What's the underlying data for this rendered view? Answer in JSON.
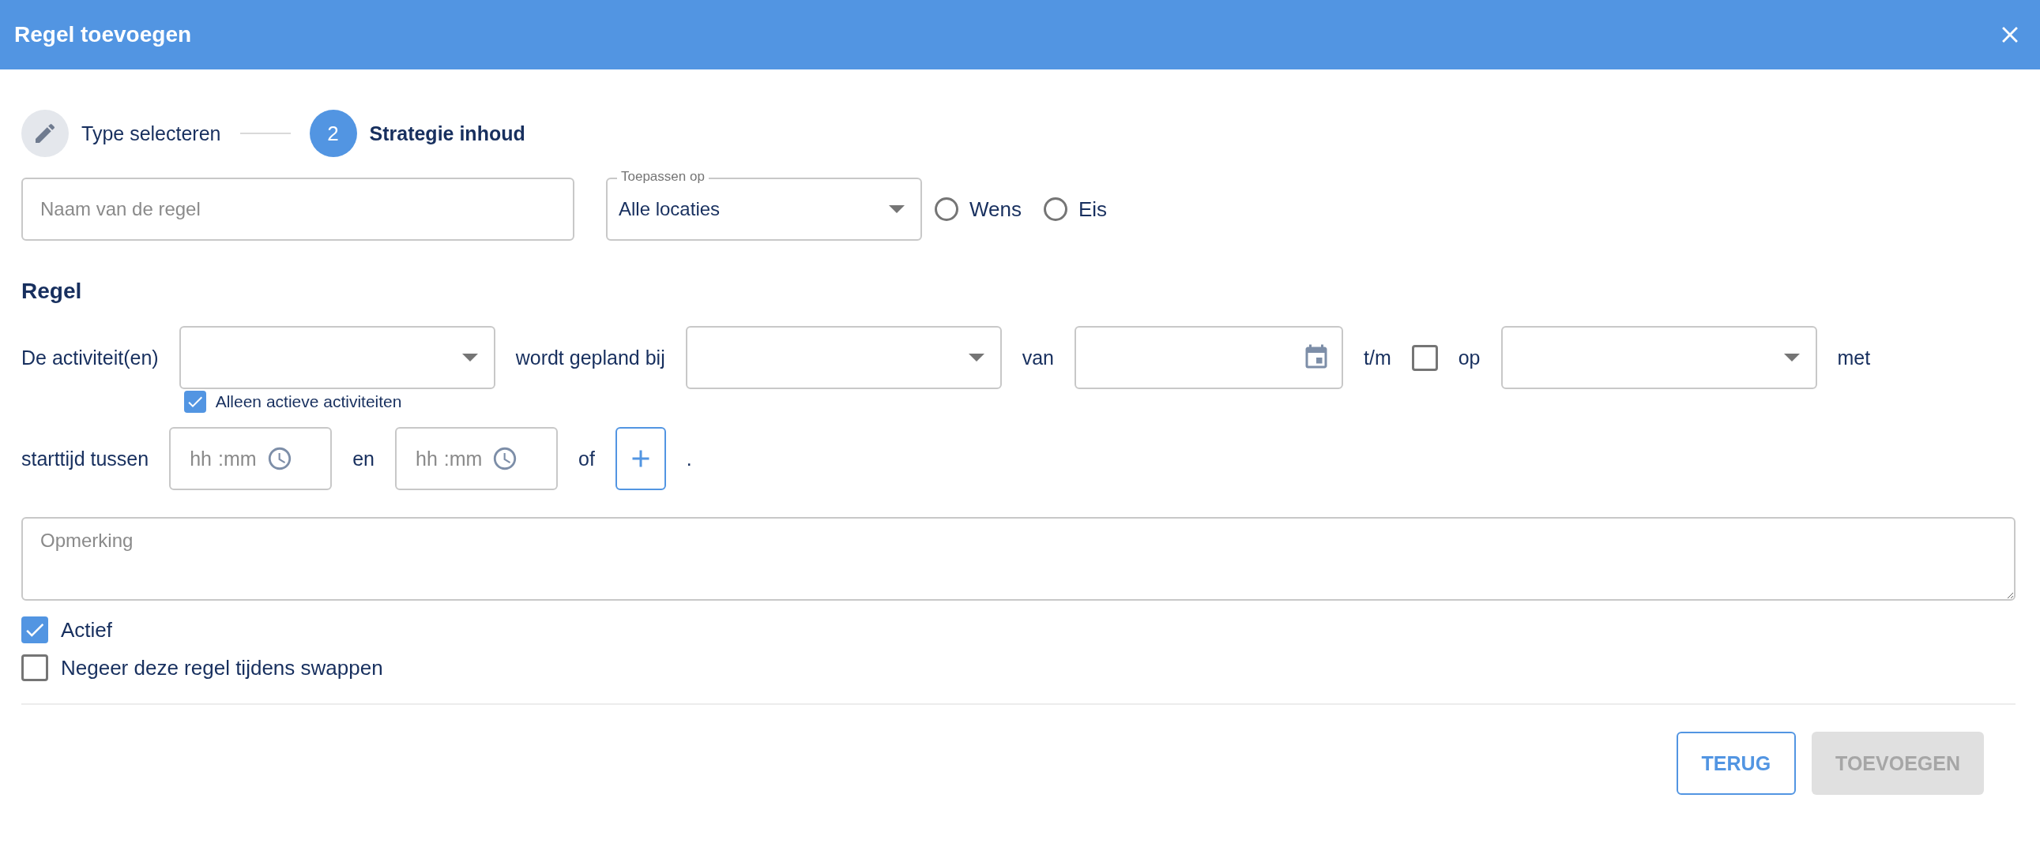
{
  "dialog": {
    "title": "Regel toevoegen"
  },
  "steps": [
    {
      "kind": "edit",
      "label": "Type selecteren",
      "selected": false
    },
    {
      "kind": "number",
      "number": "2",
      "label": "Strategie inhoud",
      "selected": true
    }
  ],
  "name_field": {
    "placeholder": "Naam van de regel"
  },
  "apply_to": {
    "label": "Toepassen op",
    "value": "Alle locaties"
  },
  "priority_options": [
    {
      "label": "Wens",
      "selected": false
    },
    {
      "label": "Eis",
      "selected": false
    }
  ],
  "section_title": "Regel",
  "rule_lines": [
    [
      {
        "kind": "label",
        "text": "De activiteit(en)"
      },
      {
        "kind": "select",
        "option": {
          "label": "Alleen actieve activiteiten",
          "checked": true
        }
      },
      {
        "kind": "label",
        "text": "wordt gepland bij"
      },
      {
        "kind": "select"
      },
      {
        "kind": "label",
        "text": "van"
      },
      {
        "kind": "date"
      },
      {
        "kind": "label",
        "text": "t/m"
      },
      {
        "kind": "checkbox",
        "checked": false
      },
      {
        "kind": "label",
        "text": "op"
      },
      {
        "kind": "select"
      },
      {
        "kind": "label",
        "text": "met"
      }
    ],
    [
      {
        "kind": "label",
        "text": "starttijd tussen"
      },
      {
        "kind": "time",
        "hours": "hh",
        "separator": ":",
        "minutes": "mm"
      },
      {
        "kind": "label",
        "text": "en"
      },
      {
        "kind": "time",
        "hours": "hh",
        "separator": ":",
        "minutes": "mm"
      },
      {
        "kind": "label",
        "text": "of"
      },
      {
        "kind": "add"
      },
      {
        "kind": "label",
        "text": "."
      }
    ]
  ],
  "remark": {
    "placeholder": "Opmerking"
  },
  "options": [
    {
      "label": "Actief",
      "checked": true
    },
    {
      "label": "Negeer deze regel tijdens swappen",
      "checked": false
    }
  ],
  "buttons": [
    {
      "kind": "outlined",
      "label": "TERUG",
      "disabled": false
    },
    {
      "kind": "filled",
      "label": "TOEVOEGEN",
      "disabled": true
    }
  ]
}
